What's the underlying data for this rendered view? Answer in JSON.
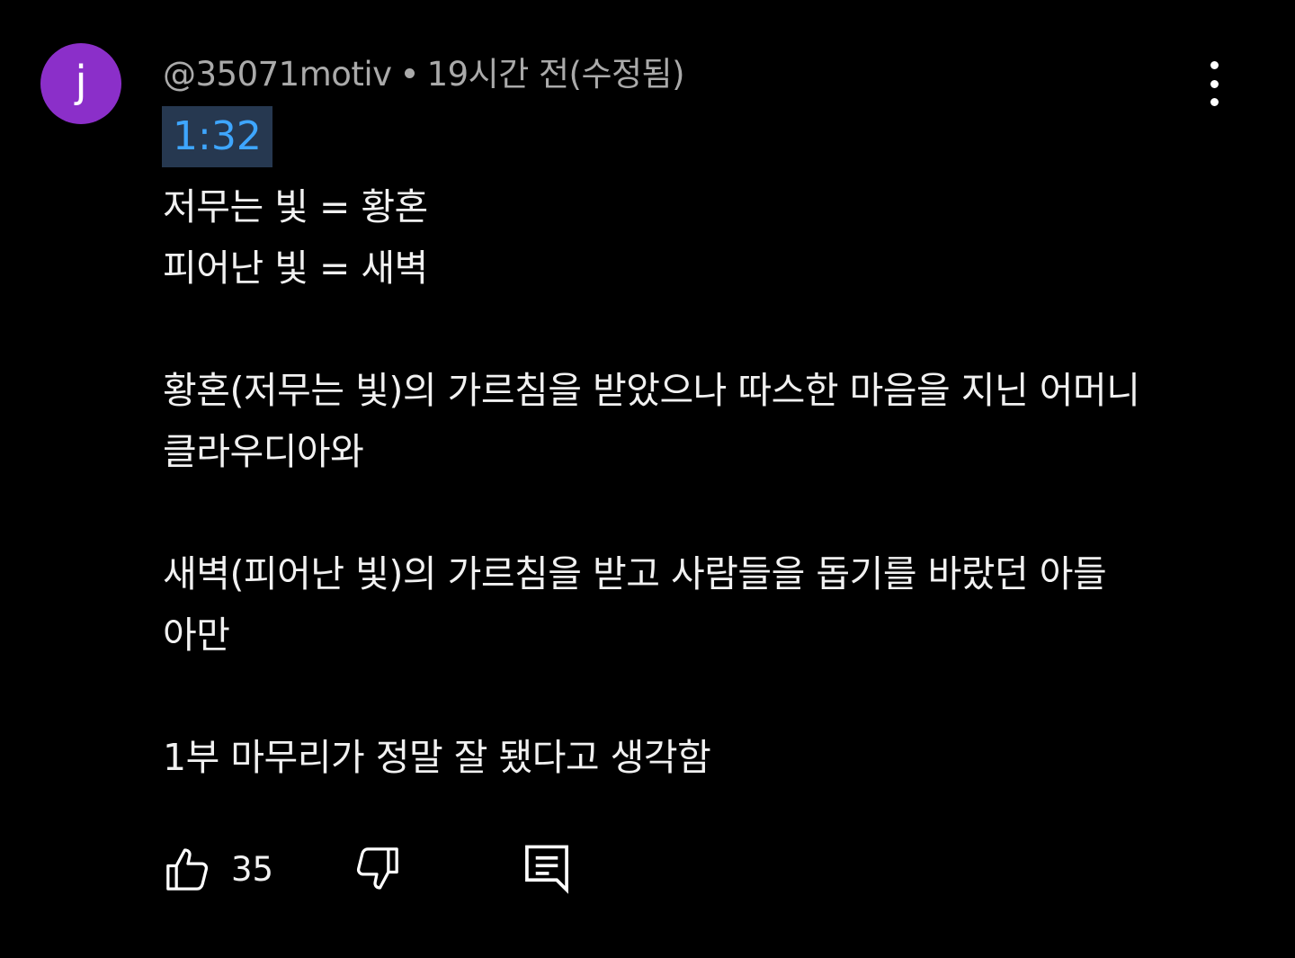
{
  "comment": {
    "avatar_letter": "j",
    "avatar_color": "#8b2fc9",
    "author": "@35071motiv",
    "time": "19시간 전(수정됨)",
    "timestamp_link": "1:32",
    "lines": {
      "l1": "저무는 빛 = 황혼",
      "l2": "피어난 빛 = 새벽",
      "l3": "황혼(저무는 빛)의 가르침을 받았으나 따스한 마음을 지닌 어머니",
      "l4": "클라우디아와",
      "l5": "새벽(피어난 빛)의 가르침을 받고 사람들을 돕기를 바랐던 아들",
      "l6": "아만",
      "l7": "1부 마무리가 정말 잘 됐다고 생각함"
    },
    "like_count": "35",
    "icons": {
      "more": "more-vertical-icon",
      "like": "thumbs-up-icon",
      "dislike": "thumbs-down-icon",
      "reply": "reply-comment-icon"
    }
  }
}
